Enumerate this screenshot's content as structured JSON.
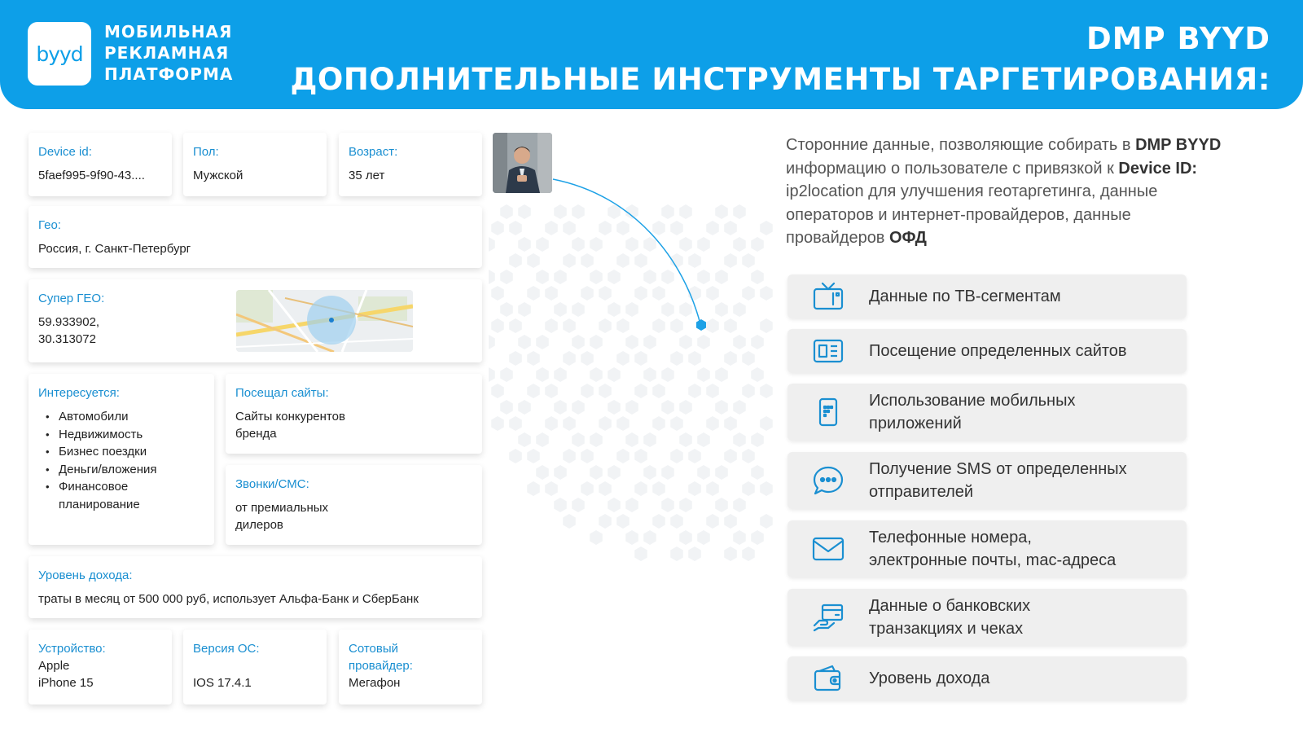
{
  "header": {
    "logo_text": "byyd",
    "brand_lines": [
      "МОБИЛЬНАЯ",
      "РЕКЛАМНАЯ",
      "ПЛАТФОРМА"
    ],
    "title_line1": "DMP BYYD",
    "title_line2": "ДОПОЛНИТЕЛЬНЫЕ ИНСТРУМЕНТЫ ТАРГЕТИРОВАНИЯ:"
  },
  "profile": {
    "device_id": {
      "label": "Device id:",
      "value": "5faef995-9f90-43...."
    },
    "gender": {
      "label": "Пол:",
      "value": "Мужской"
    },
    "age": {
      "label": "Возраст:",
      "value": "35 лет"
    },
    "geo": {
      "label": "Гео:",
      "value": "Россия, г. Санкт-Петербург"
    },
    "super_geo": {
      "label": "Супер ГЕО:",
      "value_line1": "59.933902,",
      "value_line2": "30.313072"
    },
    "interests": {
      "label": "Интересуется:",
      "items": [
        "Автомобили",
        "Недвижимость",
        "Бизнес поездки",
        "Деньги/вложения",
        "Финансовое",
        "планирование"
      ]
    },
    "visited_sites": {
      "label": "Посещал сайты:",
      "value_line1": "Сайты конкурентов",
      "value_line2": "бренда"
    },
    "calls_sms": {
      "label": "Звонки/СМС:",
      "value_line1": "от премиальных",
      "value_line2": "дилеров"
    },
    "income": {
      "label": "Уровень дохода:",
      "value": "траты в месяц от 500 000 руб, использует Альфа-Банк и СберБанк"
    },
    "device": {
      "label": "Устройство:",
      "value_line1": "Apple",
      "value_line2": "iPhone 15"
    },
    "os_version": {
      "label": "Версия ОС:",
      "value": "IOS 17.4.1"
    },
    "carrier": {
      "label_line1": "Сотовый",
      "label_line2": "провайдер:",
      "value": "Мегафон"
    }
  },
  "description": {
    "part1": "Сторонние данные, позволяющие собирать в ",
    "bold1": "DMP BYYD",
    "part2": " информацию о пользователе с привязкой к ",
    "bold2": "Device ID:",
    "part3": " ip2location для улучшения геотаргетинга, данные операторов и интернет-провайдеров, данные провайдеров ",
    "bold3": "ОФД"
  },
  "features": [
    {
      "icon": "tv-icon",
      "line1": "Данные по ТВ-сегментам",
      "line2": ""
    },
    {
      "icon": "website-icon",
      "line1": "Посещение определенных сайтов",
      "line2": ""
    },
    {
      "icon": "mobile-app-icon",
      "line1": "Использование мобильных",
      "line2": "приложений"
    },
    {
      "icon": "sms-chat-icon",
      "line1": "Получение SMS от определенных",
      "line2": "отправителей"
    },
    {
      "icon": "envelope-icon",
      "line1": "Телефонные номера,",
      "line2": "электронные почты, mac-адреса"
    },
    {
      "icon": "bank-transaction-icon",
      "line1": "Данные о банковских",
      "line2": "транзакциях и чеках"
    },
    {
      "icon": "wallet-icon",
      "line1": "Уровень дохода",
      "line2": ""
    }
  ],
  "colors": {
    "accent": "#0d9fe8",
    "label": "#1a8fd1",
    "feature_bg": "#efefef"
  }
}
